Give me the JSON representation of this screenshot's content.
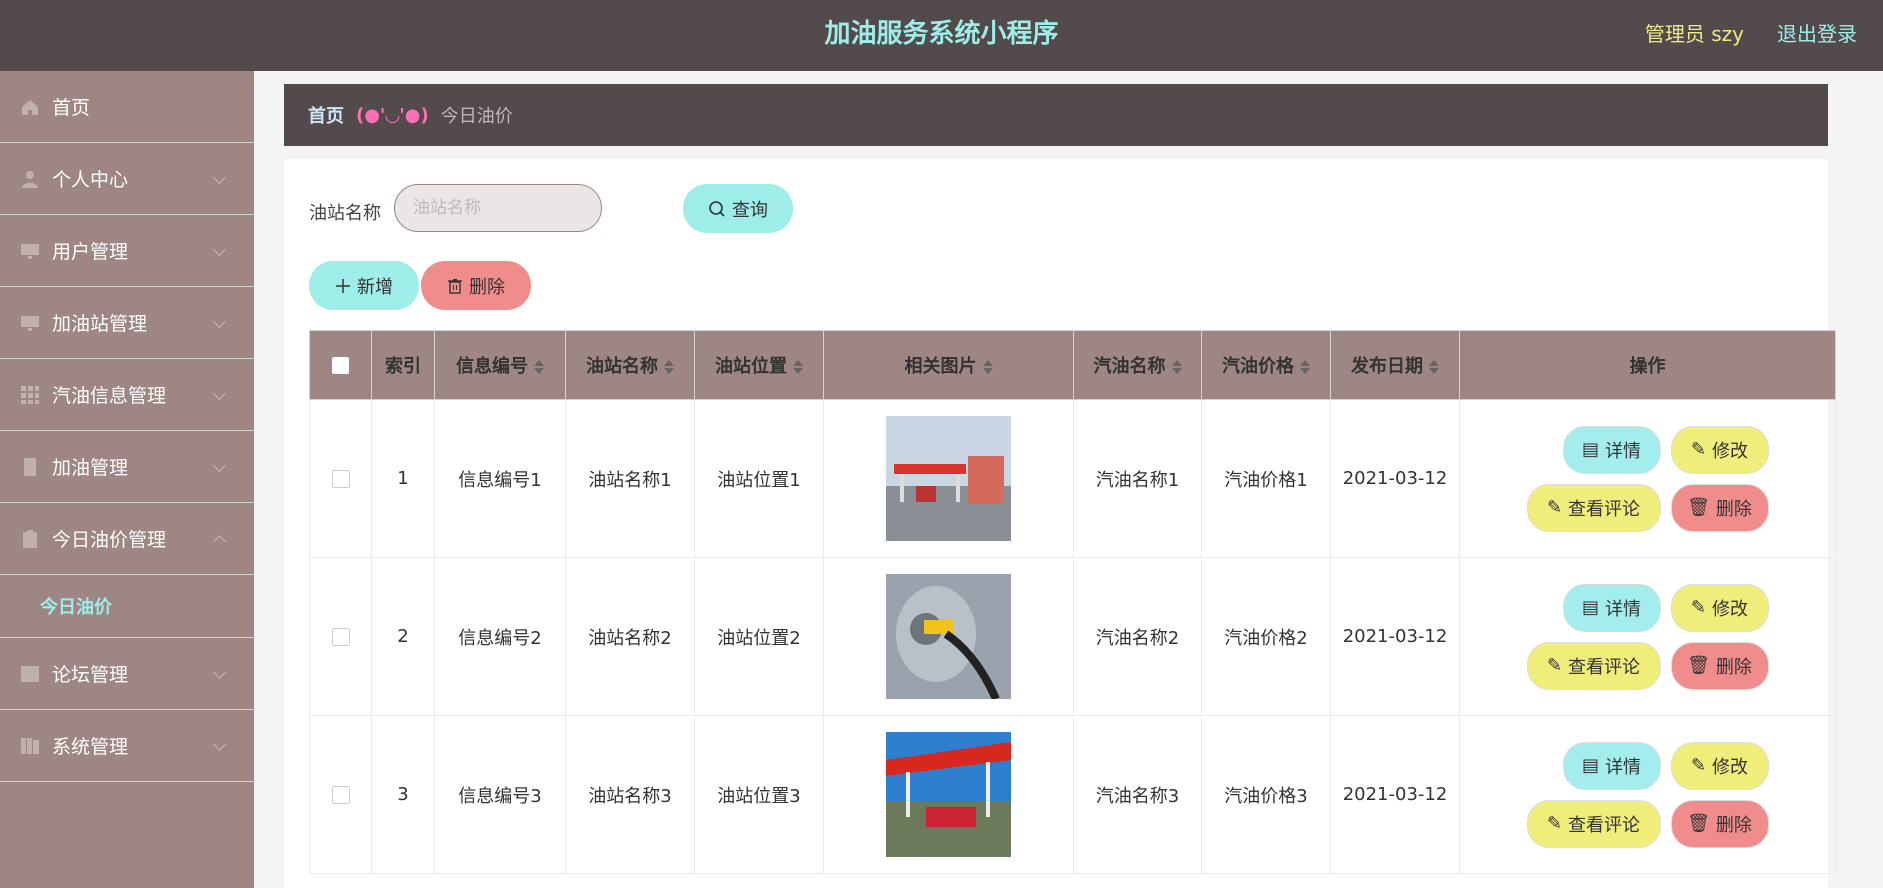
{
  "header": {
    "title": "加油服务系统小程序",
    "admin_label": "管理员 szy",
    "logout_label": "退出登录"
  },
  "sidebar": {
    "items": [
      {
        "label": "首页",
        "icon": "home-icon"
      },
      {
        "label": "个人中心",
        "icon": "user-icon"
      },
      {
        "label": "用户管理",
        "icon": "monitor-icon"
      },
      {
        "label": "加油站管理",
        "icon": "monitor-icon"
      },
      {
        "label": "汽油信息管理",
        "icon": "grid-icon"
      },
      {
        "label": "加油管理",
        "icon": "document-icon"
      },
      {
        "label": "今日油价管理",
        "icon": "clipboard-icon"
      },
      {
        "label": "论坛管理",
        "icon": "chart-icon"
      },
      {
        "label": "系统管理",
        "icon": "folder-icon"
      }
    ],
    "active_sub": "今日油价"
  },
  "breadcrumb": {
    "home": "首页",
    "separator": "(●'◡'●)",
    "current": "今日油价"
  },
  "search": {
    "label": "油站名称",
    "placeholder": "油站名称",
    "query_button": "查询"
  },
  "actions": {
    "add": "新增",
    "delete": "删除"
  },
  "table": {
    "columns": [
      "索引",
      "信息编号",
      "油站名称",
      "油站位置",
      "相关图片",
      "汽油名称",
      "汽油价格",
      "发布日期",
      "操作"
    ],
    "op_labels": {
      "detail": "详情",
      "edit": "修改",
      "comment": "查看评论",
      "delete": "删除"
    },
    "rows": [
      {
        "index": "1",
        "info_no": "信息编号1",
        "station_name": "油站名称1",
        "station_location": "油站位置1",
        "gas_name": "汽油名称1",
        "gas_price": "汽油价格1",
        "date": "2021-03-12"
      },
      {
        "index": "2",
        "info_no": "信息编号2",
        "station_name": "油站名称2",
        "station_location": "油站位置2",
        "gas_name": "汽油名称2",
        "gas_price": "汽油价格2",
        "date": "2021-03-12"
      },
      {
        "index": "3",
        "info_no": "信息编号3",
        "station_name": "油站名称3",
        "station_location": "油站位置3",
        "gas_name": "汽油名称3",
        "gas_price": "汽油价格3",
        "date": "2021-03-12"
      }
    ]
  },
  "colors": {
    "header_bg": "#524a4b",
    "sidebar_bg": "#9e8685",
    "accent_cyan": "#9fede9",
    "accent_yellow": "#f0ee7a",
    "accent_red": "#f08c8b"
  }
}
